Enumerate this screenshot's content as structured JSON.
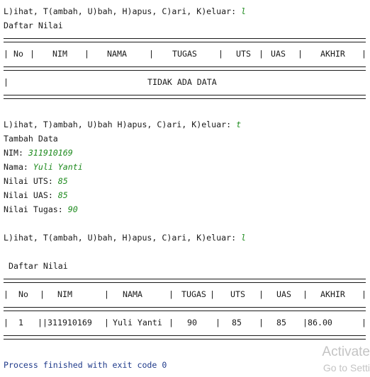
{
  "console": {
    "menu_prompt_1": "L)ihat, T(ambah, U)bah, H)apus, C)ari, K)eluar: ",
    "input_1": "l",
    "daftar_1": "Daftar Nilai",
    "table1": {
      "headers": [
        "No",
        "NIM",
        "NAMA",
        "TUGAS",
        "UTS",
        "UAS",
        "AKHIR"
      ],
      "empty_message": "TIDAK ADA DATA"
    },
    "menu_prompt_2": "L)ihat, T)ambah, U)bah H)apus, C)ari, K)eluar: ",
    "input_2": "t",
    "tambah_title": "Tambah Data",
    "nim_label": "NIM: ",
    "nim_value": "311910169",
    "nama_label": "Nama: ",
    "nama_value": "Yuli Yanti",
    "uts_label": "Nilai UTS: ",
    "uts_value": "85",
    "uas_label": "Nilai UAS: ",
    "uas_value": "85",
    "tugas_label": "Nilai Tugas: ",
    "tugas_value": "90",
    "menu_prompt_3": "L)ihat, T(ambah, U)bah, H)apus, C)ari, K)eluar: ",
    "input_3": "l",
    "daftar_2": "Daftar Nilai",
    "table2": {
      "headers": [
        "No",
        "NIM",
        "NAMA",
        "TUGAS",
        "UTS",
        "UAS",
        "AKHIR"
      ],
      "row": [
        "1",
        "311910169",
        "Yuli Yanti",
        "90",
        "85",
        "85",
        "86.00"
      ]
    },
    "exit_message": "Process finished with exit code 0"
  },
  "watermark": {
    "title": "Activate",
    "subtitle": "Go to Setti"
  }
}
